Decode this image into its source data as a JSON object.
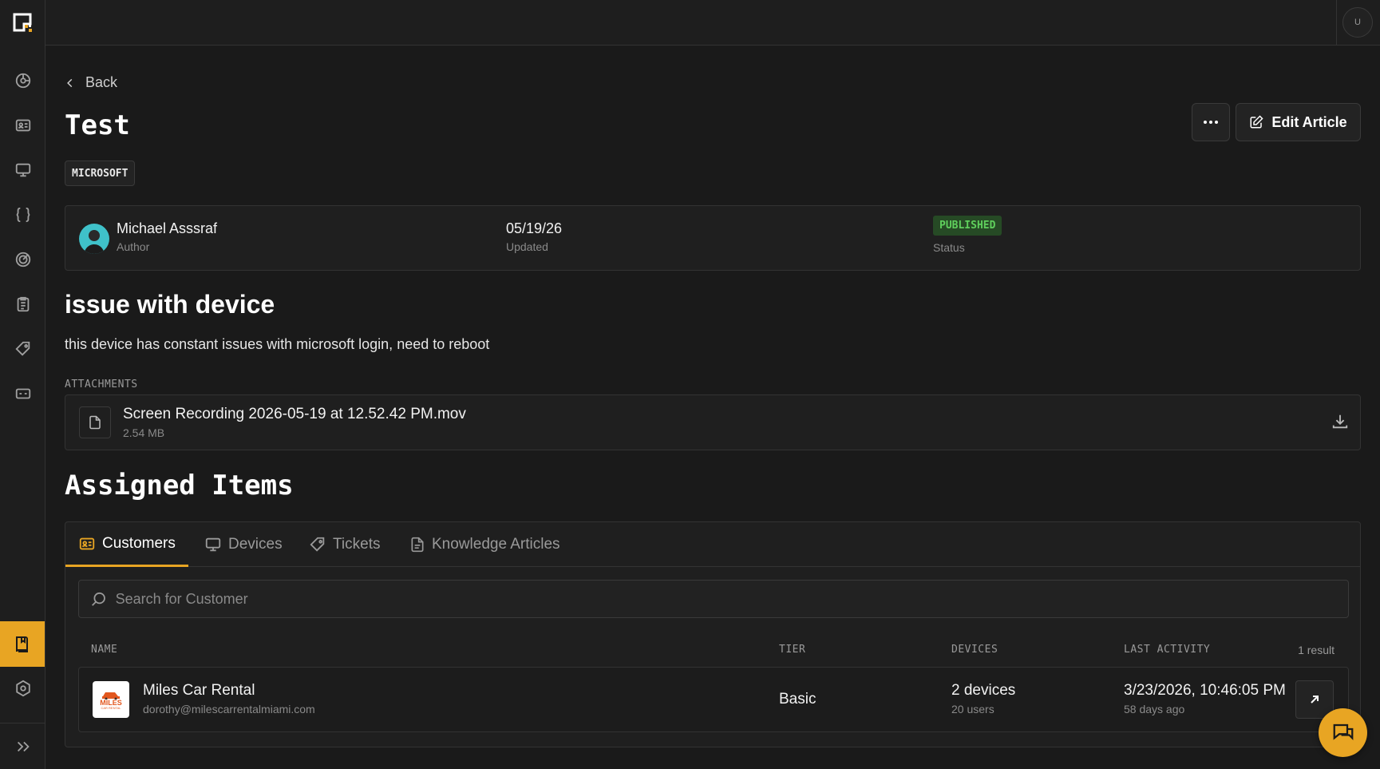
{
  "user": {
    "initial": "U"
  },
  "nav": {
    "items": [
      "dashboard-icon",
      "contacts-icon",
      "monitor-icon",
      "code-braces-icon",
      "target-icon",
      "clipboard-icon",
      "tag-icon",
      "ticket-icon"
    ],
    "active": "knowledge-base-icon",
    "bottom": [
      "settings-icon",
      "expand-icon"
    ]
  },
  "header": {
    "back_label": "Back",
    "title": "Test",
    "edit_label": "Edit Article",
    "tag": "MICROSOFT"
  },
  "info": {
    "author_name": "Michael Asssraf",
    "author_label": "Author",
    "updated_value": "05/19/26",
    "updated_label": "Updated",
    "status_value": "PUBLISHED",
    "status_label": "Status",
    "status_color": "#5fcf5c"
  },
  "article": {
    "heading": "issue with device",
    "body": "this device has constant issues with microsoft login, need to reboot"
  },
  "attachments": {
    "label": "ATTACHMENTS",
    "files": [
      {
        "name": "Screen Recording 2026-05-19 at 12.52.42 PM.mov",
        "size": "2.54 MB"
      }
    ]
  },
  "assigned": {
    "heading": "Assigned Items",
    "tabs": [
      {
        "label": "Customers",
        "icon": "contacts-icon",
        "active": true
      },
      {
        "label": "Devices",
        "icon": "monitor-icon",
        "active": false
      },
      {
        "label": "Tickets",
        "icon": "tag-icon",
        "active": false
      },
      {
        "label": "Knowledge Articles",
        "icon": "document-icon",
        "active": false
      }
    ],
    "search_placeholder": "Search for Customer",
    "columns": [
      "NAME",
      "TIER",
      "DEVICES",
      "LAST ACTIVITY"
    ],
    "result_count": "1 result",
    "rows": [
      {
        "logo_text_1": "MILES",
        "logo_text_2": "CAR RENTAL",
        "name": "Miles Car Rental",
        "email": "dorothy@milescarrentalmiami.com",
        "tier": "Basic",
        "devices": "2 devices",
        "users": "20 users",
        "last_activity": "3/23/2026, 10:46:05 PM",
        "last_activity_rel": "58 days ago"
      }
    ]
  },
  "colors": {
    "accent": "#e8a523",
    "background": "#1a1a1a"
  }
}
